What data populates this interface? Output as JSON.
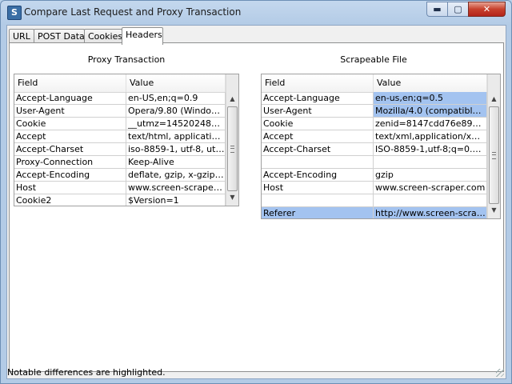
{
  "window": {
    "title": "Compare Last Request and Proxy Transaction",
    "app_icon": "S"
  },
  "caption_buttons": {
    "minimize": "▬",
    "maximize": "▢",
    "close": "✕"
  },
  "tabs": [
    {
      "label": "URL"
    },
    {
      "label": "POST Data"
    },
    {
      "label": "Cookies"
    },
    {
      "label": "Headers",
      "active": true
    }
  ],
  "left": {
    "title": "Proxy Transaction",
    "columns": [
      "Field",
      "Value"
    ],
    "rows": [
      {
        "field": "Accept-Language",
        "value": "en-US,en;q=0.9",
        "hl": false
      },
      {
        "field": "User-Agent",
        "value": "Opera/9.80 (Windows NT ...",
        "hl": false
      },
      {
        "field": "Cookie",
        "value": "__utmz=145202486.1278...",
        "hl": false
      },
      {
        "field": "Accept",
        "value": "text/html, application/xml...",
        "hl": false
      },
      {
        "field": "Accept-Charset",
        "value": "iso-8859-1, utf-8, utf-16,...",
        "hl": false
      },
      {
        "field": "Proxy-Connection",
        "value": "Keep-Alive",
        "hl": false
      },
      {
        "field": "Accept-Encoding",
        "value": "deflate, gzip, x-gzip, iden...",
        "hl": false
      },
      {
        "field": "Host",
        "value": "www.screen-scraper.com",
        "hl": false
      },
      {
        "field": "Cookie2",
        "value": "$Version=1",
        "hl": false
      }
    ]
  },
  "right": {
    "title": "Scrapeable File",
    "columns": [
      "Field",
      "Value"
    ],
    "rows": [
      {
        "field": "Accept-Language",
        "value": "en-us,en;q=0.5",
        "hl": "value"
      },
      {
        "field": "User-Agent",
        "value": "Mozilla/4.0 (compatible; M...",
        "hl": "value"
      },
      {
        "field": "Cookie",
        "value": "zenid=8147cdd76e8915a...",
        "hl": false
      },
      {
        "field": "Accept",
        "value": "text/xml,application/xml,a...",
        "hl": false
      },
      {
        "field": "Accept-Charset",
        "value": "ISO-8859-1,utf-8;q=0.7,...",
        "hl": false
      },
      {
        "field": "",
        "value": "",
        "hl": false
      },
      {
        "field": "Accept-Encoding",
        "value": "gzip",
        "hl": false
      },
      {
        "field": "Host",
        "value": "www.screen-scraper.com",
        "hl": false
      },
      {
        "field": "",
        "value": "",
        "hl": false
      },
      {
        "field": "Referer",
        "value": "http://www.screen-scrap...",
        "hl": "row"
      }
    ]
  },
  "status": {
    "text": "Notable differences are highlighted."
  },
  "scroll_glyphs": {
    "up": "▲",
    "down": "▼"
  }
}
